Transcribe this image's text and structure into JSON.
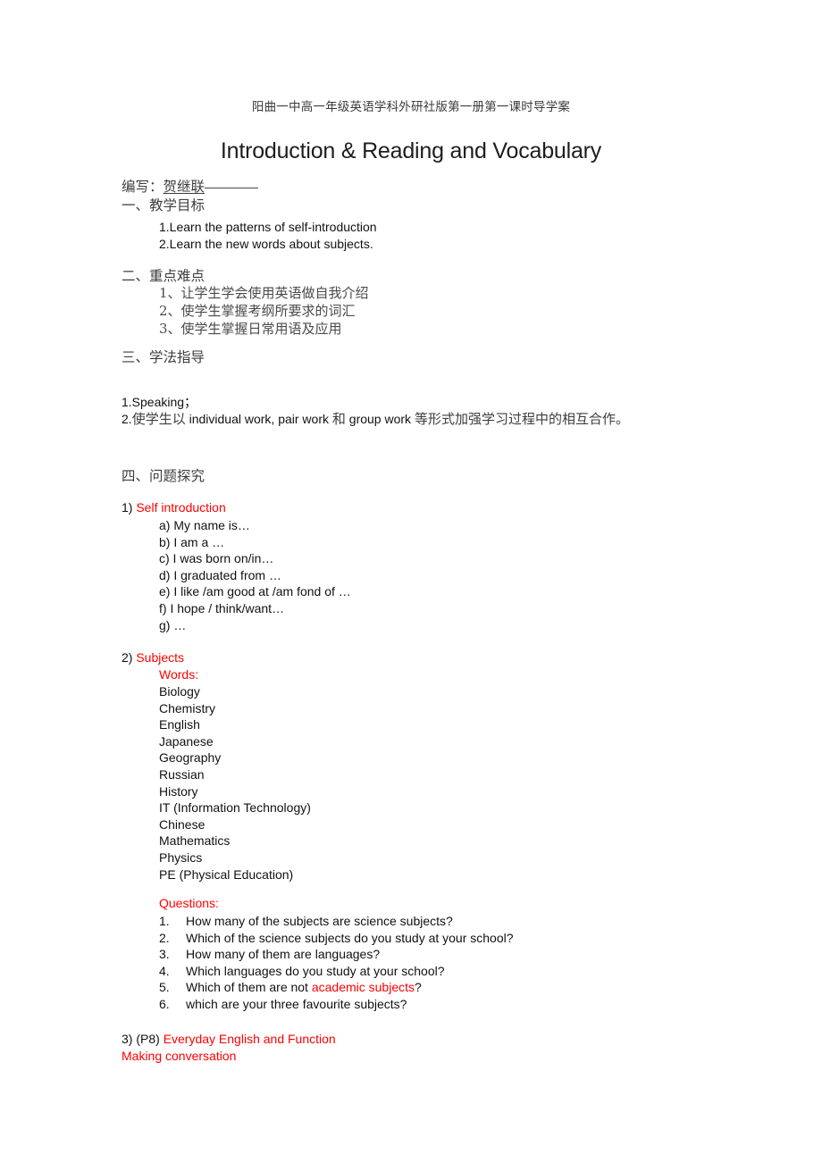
{
  "document": {
    "header_line": "阳曲一中高一年级英语学科外研社版第一册第一课时导学案",
    "title": "Introduction & Reading and Vocabulary",
    "byline_label": "编写：",
    "byline_name": "贺继联"
  },
  "colors": {
    "red": "#ff0000",
    "body_text": "#111111",
    "chinese_text": "#3d3d3d"
  },
  "sections": {
    "one": {
      "heading": "一、教学目标",
      "items": [
        "1.Learn the patterns of self-introduction",
        "2.Learn the new words about subjects."
      ]
    },
    "two": {
      "heading": "二、重点难点",
      "items": [
        "1、让学生学会使用英语做自我介绍",
        "2、使学生掌握考纲所要求的词汇",
        "3、使学生掌握日常用语及应用"
      ]
    },
    "three": {
      "heading": "三、学法指导",
      "item1": "1.Speaking；",
      "item2_pre": "2.",
      "item2_zh1": "使学生以",
      "item2_en1": " individual work, pair work ",
      "item2_zh2": "和",
      "item2_en2": " group work ",
      "item2_zh3": " 等形式加强学习过程中的相互合作。"
    },
    "four": {
      "heading": "四、问题探究",
      "part1": {
        "number": "1)",
        "title": "Self introduction",
        "items": [
          "a) My name is…",
          "b) I am a …",
          "c) I was born on/in…",
          "d) I graduated from …",
          "e) I like /am good at /am fond of …",
          "f) I hope / think/want…",
          "g) …"
        ]
      },
      "part2": {
        "number": "2)",
        "title": "Subjects",
        "words_label": "Words:",
        "words": [
          "Biology",
          "Chemistry",
          "English",
          "Japanese",
          "Geography",
          "Russian",
          "History",
          "IT (Information Technology)",
          "Chinese",
          "Mathematics",
          "Physics",
          "PE (Physical Education)"
        ],
        "questions_label": "Questions:",
        "questions": [
          {
            "num": "1.",
            "text": "How many of the subjects are science subjects?"
          },
          {
            "num": "2.",
            "text": "Which of the science subjects do you study at your school?"
          },
          {
            "num": "3.",
            "text": "How many of them are languages?"
          },
          {
            "num": "4.",
            "text": "Which languages do you study at your school?"
          },
          {
            "num": "5.",
            "text": "Which of them are not ",
            "highlight": "academic subjects",
            "tail": "?"
          },
          {
            "num": "6.",
            "text": "which are your three favourite subjects?"
          }
        ]
      },
      "part3": {
        "number": "3) (P8) ",
        "title": "Everyday English and Function",
        "subtitle": "Making conversation"
      }
    }
  }
}
